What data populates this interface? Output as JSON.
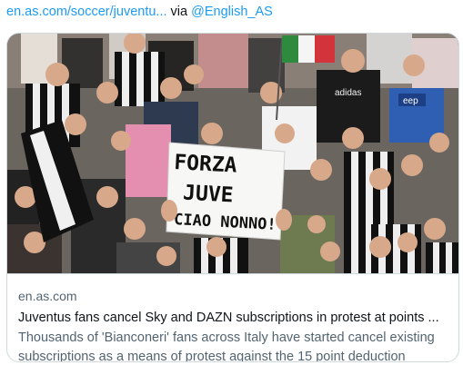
{
  "attribution": {
    "link_text": "en.as.com/soccer/juventu...",
    "via_text": "via",
    "handle": "@English_AS"
  },
  "card": {
    "image": {
      "sign_lines": [
        "FORZA",
        "JUVE",
        "CIAO NONNO!"
      ],
      "jersey_brand": "adidas",
      "jersey_sponsor": "eep"
    },
    "domain": "en.as.com",
    "title": "Juventus fans cancel Sky and DAZN subscriptions in protest at points ...",
    "description": "Thousands of 'Bianconeri' fans across Italy have started cancel existing subscriptions as a means of protest against the 15 point deduction"
  },
  "colors": {
    "link": "#1d9bf0",
    "text": "#0f1419",
    "muted": "#536471",
    "border": "#cfd9de"
  }
}
